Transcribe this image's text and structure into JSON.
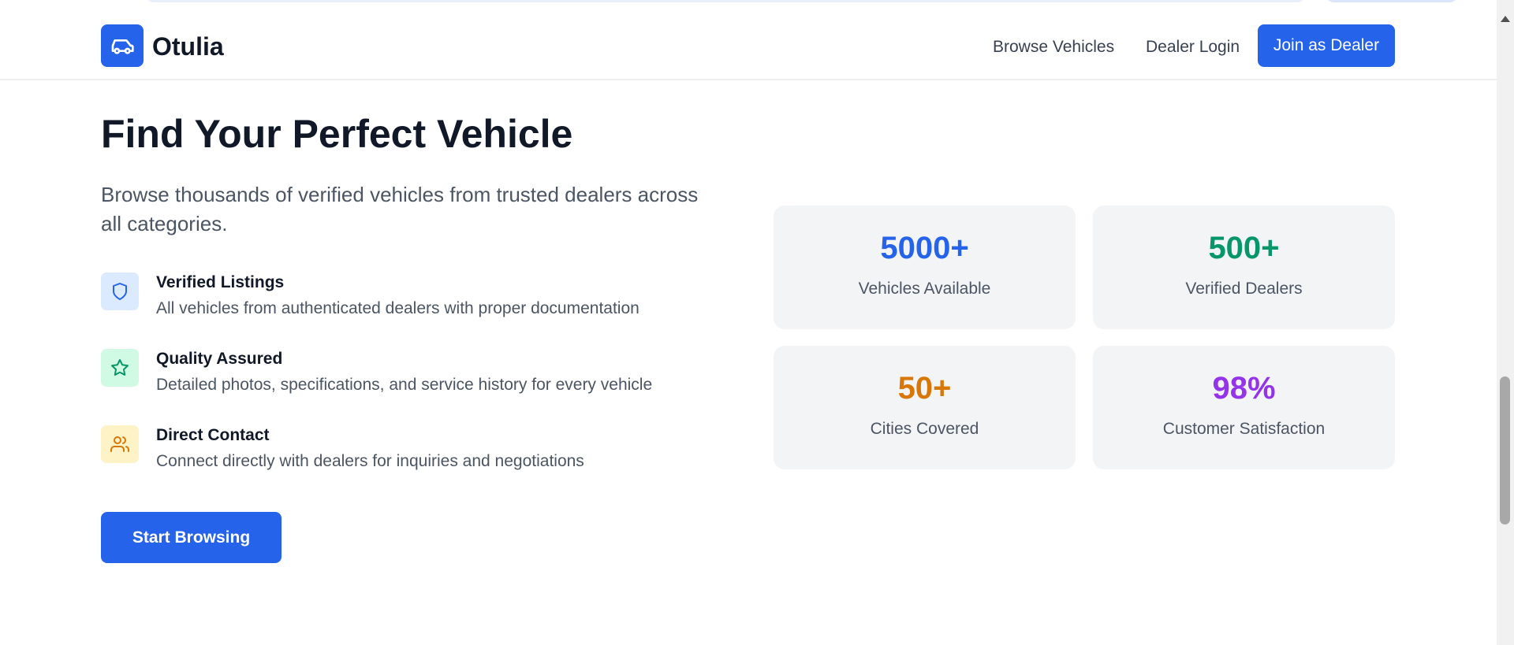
{
  "header": {
    "brand": "Otulia",
    "nav": {
      "browse": "Browse Vehicles",
      "login": "Dealer Login",
      "join": "Join as Dealer"
    }
  },
  "hero": {
    "title": "Find Your Perfect Vehicle",
    "subtitle": "Browse thousands of verified vehicles from trusted dealers across all categories.",
    "features": [
      {
        "title": "Verified Listings",
        "description": "All vehicles from authenticated dealers with proper documentation",
        "icon": "shield-icon"
      },
      {
        "title": "Quality Assured",
        "description": "Detailed photos, specifications, and service history for every vehicle",
        "icon": "star-icon"
      },
      {
        "title": "Direct Contact",
        "description": "Connect directly with dealers for inquiries and negotiations",
        "icon": "users-icon"
      }
    ],
    "cta": "Start Browsing"
  },
  "stats": [
    {
      "value": "5000+",
      "label": "Vehicles Available",
      "color": "#2563eb"
    },
    {
      "value": "500+",
      "label": "Verified Dealers",
      "color": "#059669"
    },
    {
      "value": "50+",
      "label": "Cities Covered",
      "color": "#d97706"
    },
    {
      "value": "98%",
      "label": "Customer Satisfaction",
      "color": "#9333ea"
    }
  ],
  "colors": {
    "primary": "#2563eb",
    "text_dark": "#111827",
    "text_muted": "#4b5563",
    "card_bg": "#f3f4f6"
  }
}
